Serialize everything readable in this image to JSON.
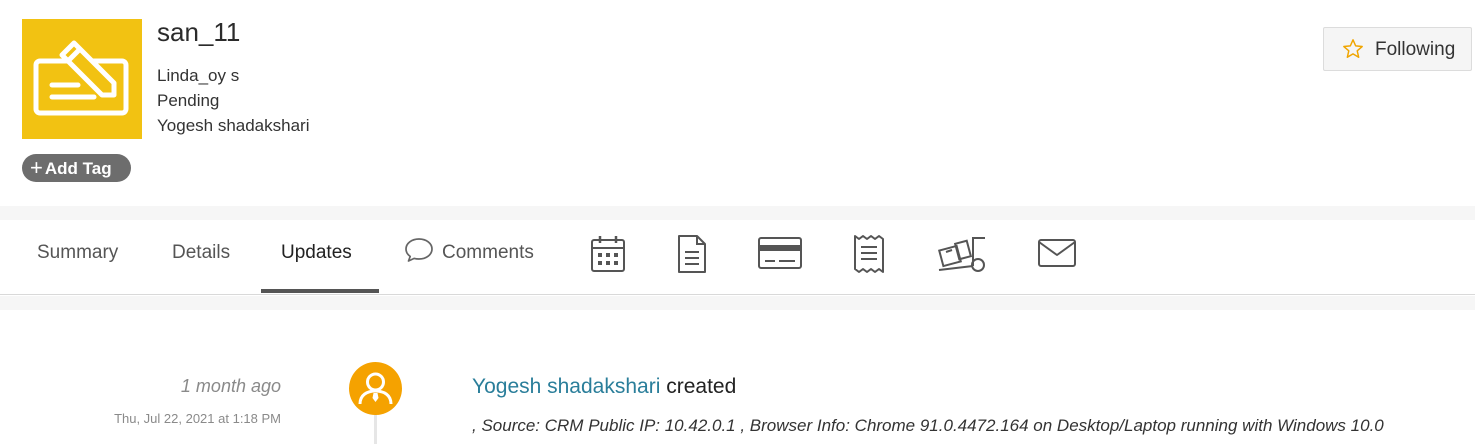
{
  "record": {
    "title": "san_11",
    "contact": "Linda_oy s",
    "status": "Pending",
    "owner": "Yogesh shadakshari",
    "add_tag_label": "Add Tag",
    "follow_label": "Following"
  },
  "tabs": [
    {
      "label": "Summary"
    },
    {
      "label": "Details"
    },
    {
      "label": "Updates",
      "active": true
    },
    {
      "label": "Comments",
      "icon": "chat-bubble-icon"
    }
  ],
  "tab_icons": [
    "calendar-icon",
    "document-icon",
    "credit-card-icon",
    "receipt-icon",
    "delivery-truck-icon",
    "envelope-icon"
  ],
  "update": {
    "relative_time": "1 month ago",
    "timestamp": "Thu, Jul 22, 2021 at 1:18 PM",
    "user": "Yogesh shadakshari",
    "action": "created",
    "detail": ", Source: CRM Public IP: 10.42.0.1 , Browser Info: Chrome 91.0.4472.164 on Desktop/Laptop running with Windows 10.0"
  },
  "colors": {
    "logo_bg": "#f2c212",
    "avatar_bg": "#f5a200",
    "link": "#2a7e9a",
    "tag_bg": "#6d6d6d"
  }
}
